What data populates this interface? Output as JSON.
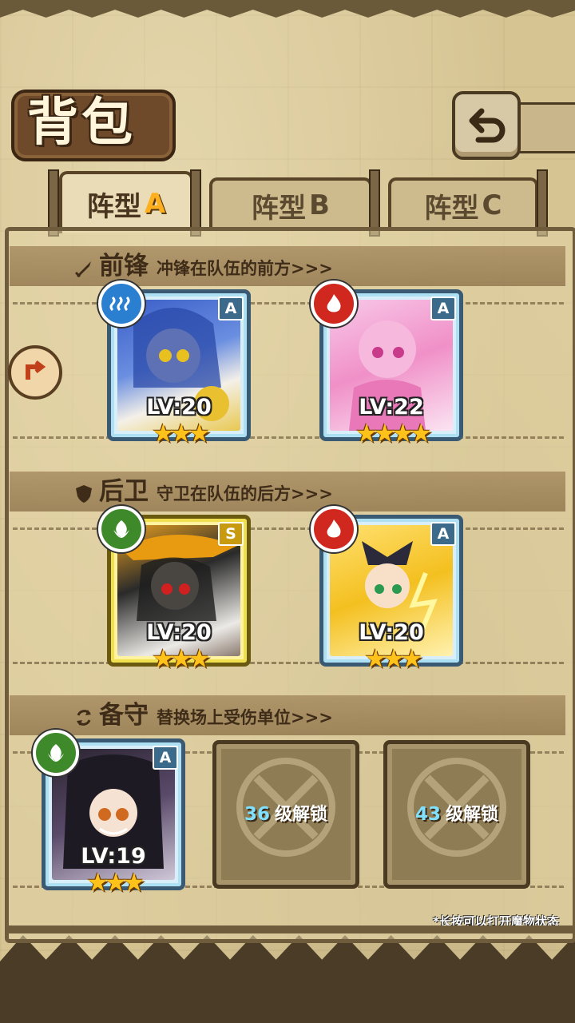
{
  "title": "背包",
  "tabs": [
    {
      "label": "阵型",
      "suffix": "A",
      "active": true
    },
    {
      "label": "阵型",
      "suffix": "B",
      "active": false
    },
    {
      "label": "阵型",
      "suffix": "C",
      "active": false
    }
  ],
  "sections": {
    "front": {
      "title": "前锋",
      "desc": "冲锋在队伍的前方>>>",
      "icon": "sword-icon"
    },
    "back": {
      "title": "后卫",
      "desc": "守卫在队伍的后方>>>",
      "icon": "shield-icon"
    },
    "reserve": {
      "title": "备守",
      "desc": "替换场上受伤单位>>>",
      "icon": "swap-icon"
    }
  },
  "units": {
    "front1": {
      "level": "LV:20",
      "stars": "★★★",
      "rank": "A",
      "element": "water-icon"
    },
    "front2": {
      "level": "LV:22",
      "stars": "★★★★",
      "rank": "A",
      "element": "fire-icon"
    },
    "back1": {
      "level": "LV:20",
      "stars": "★★★",
      "rank": "S",
      "element": "wood-icon"
    },
    "back2": {
      "level": "LV:20",
      "stars": "★★★",
      "rank": "A",
      "element": "fire-icon"
    },
    "reserve1": {
      "level": "LV:19",
      "stars": "★★★",
      "rank": "A",
      "element": "wood-icon"
    }
  },
  "locked_slots": [
    {
      "level": "36",
      "text": "级解锁"
    },
    {
      "level": "43",
      "text": "级解锁"
    }
  ],
  "hint": "*长按可以打开魔物状态",
  "colors": {
    "water": "#2b7fd0",
    "fire": "#d0281e",
    "wood": "#3e8a2a",
    "star": "#ffc21a",
    "accent": "#ffb020"
  }
}
